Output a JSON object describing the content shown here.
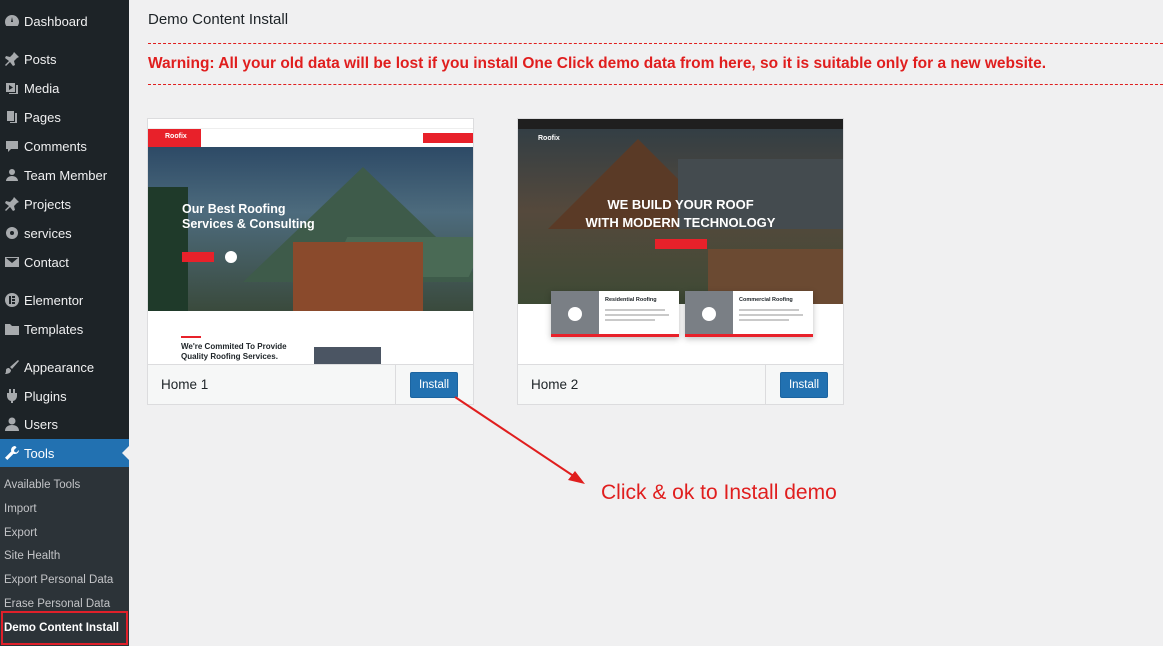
{
  "sidebar": {
    "items": [
      {
        "label": "Dashboard",
        "icon": "dashboard-icon"
      },
      {
        "label": "Posts",
        "icon": "pin-icon"
      },
      {
        "label": "Media",
        "icon": "media-icon"
      },
      {
        "label": "Pages",
        "icon": "pages-icon"
      },
      {
        "label": "Comments",
        "icon": "comment-icon"
      },
      {
        "label": "Team Member",
        "icon": "users-icon"
      },
      {
        "label": "Projects",
        "icon": "pin-icon"
      },
      {
        "label": "services",
        "icon": "gear-icon"
      },
      {
        "label": "Contact",
        "icon": "mail-icon"
      },
      {
        "label": "Elementor",
        "icon": "elementor-icon"
      },
      {
        "label": "Templates",
        "icon": "folder-icon"
      },
      {
        "label": "Appearance",
        "icon": "brush-icon"
      },
      {
        "label": "Plugins",
        "icon": "plugin-icon"
      },
      {
        "label": "Users",
        "icon": "user-icon"
      },
      {
        "label": "Tools",
        "icon": "wrench-icon"
      }
    ],
    "submenu": [
      "Available Tools",
      "Import",
      "Export",
      "Site Health",
      "Export Personal Data",
      "Erase Personal Data",
      "Demo Content Install"
    ]
  },
  "page": {
    "title": "Demo Content Install",
    "warning": "Warning: All your old data will be lost if you install One Click demo data from here, so it is suitable only for a new website."
  },
  "demos": [
    {
      "name": "Home 1",
      "button": "Install",
      "preview": {
        "logo": "Roofix",
        "headline": [
          "Our Best Roofing",
          "Services & Consulting"
        ],
        "section": [
          "We're Commited To Provide",
          "Quality Roofing Services."
        ]
      }
    },
    {
      "name": "Home 2",
      "button": "Install",
      "preview": {
        "logo": "Roofix",
        "headline": [
          "WE BUILD YOUR ROOF",
          "WITH MODERN TECHNOLOGY"
        ],
        "boxes": [
          "Residential Roofing",
          "Commercial Roofing"
        ]
      }
    }
  ],
  "annotation": {
    "text": "Click & ok to Install demo"
  },
  "colors": {
    "accent": "#2271b1",
    "warning": "#e01e1e",
    "sidebar": "#1d2327"
  }
}
